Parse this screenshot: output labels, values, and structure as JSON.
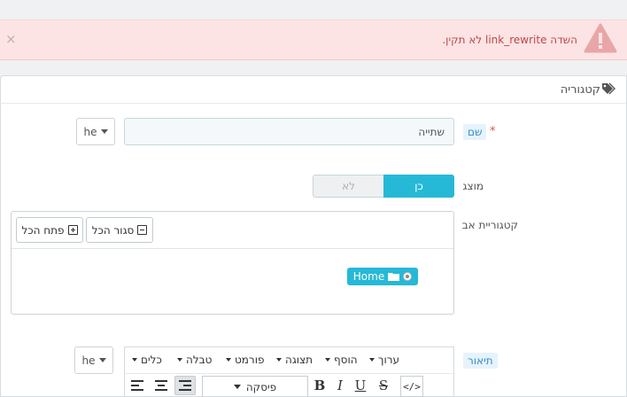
{
  "alert": {
    "message": "השדה link_rewrite לא תקין.",
    "close_label": "×"
  },
  "panel": {
    "title": "קטגוריה"
  },
  "fields": {
    "name": {
      "label": "שם",
      "required_mark": "*",
      "value": "שתייה",
      "lang": "he"
    },
    "shown": {
      "label": "מוצג",
      "yes_label": "כן",
      "no_label": "לא",
      "selected": "כן"
    },
    "parent": {
      "label": "קטגוריית אב",
      "expand_all": "פתח הכל",
      "collapse_all": "סגור הכל",
      "tree": [
        {
          "label": "Home",
          "selected": true
        }
      ]
    },
    "description": {
      "label": "תיאור",
      "lang": "he"
    }
  },
  "editor": {
    "menu": [
      "ערוך",
      "הוסף",
      "תצוגה",
      "פורמט",
      "טבלה",
      "כלים"
    ],
    "format_select": "פיסקה",
    "buttons": {
      "bold": "B",
      "italic": "I",
      "underline": "U",
      "strike": "S",
      "code": "</>"
    }
  },
  "colors": {
    "accent": "#25b9d7",
    "alert_bg": "#fde4e4",
    "alert_text": "#c0454a",
    "required": "#e3524a"
  }
}
